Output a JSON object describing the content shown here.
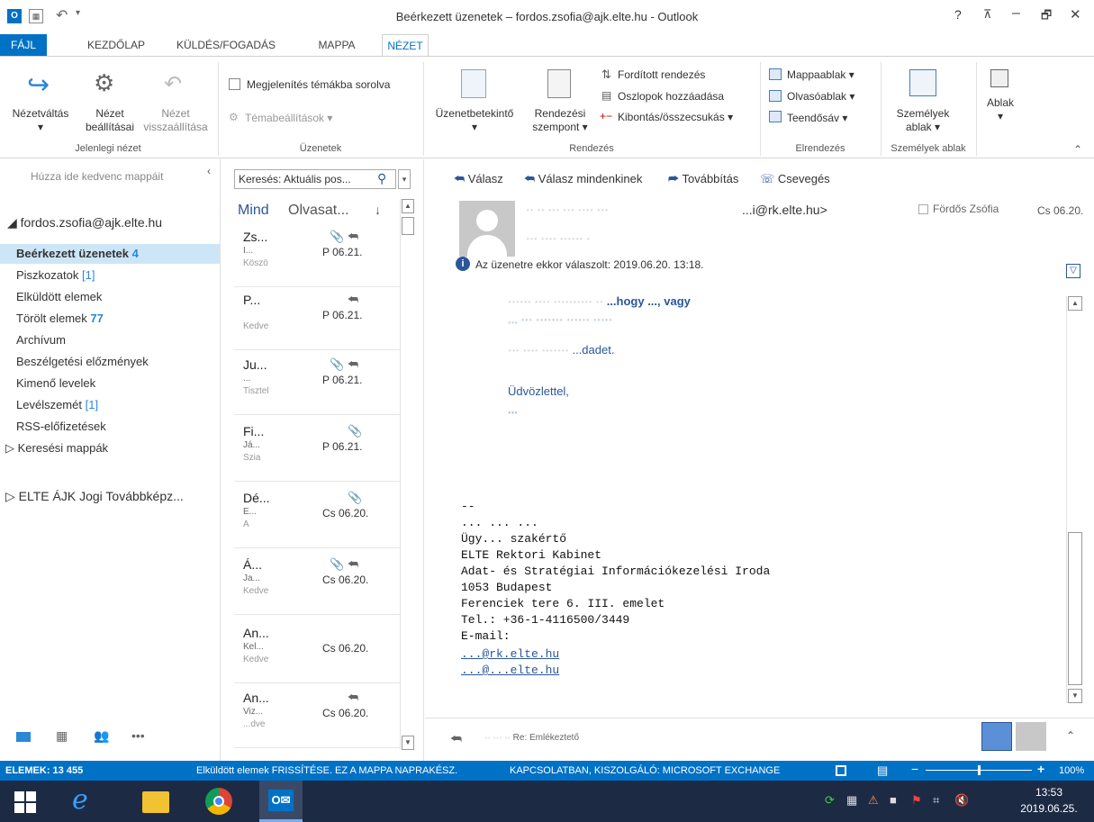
{
  "window": {
    "title": "Beérkezett üzenetek – fordos.zsofia@ajk.elte.hu - Outlook",
    "help": "?",
    "controls": {
      "restore_ribbon": "⊼",
      "minimize": "–",
      "maximize": "🗗",
      "close": "✕"
    }
  },
  "tabs": [
    {
      "label": "FÁJL"
    },
    {
      "label": "KEZDŐLAP"
    },
    {
      "label": "KÜLDÉS/FOGADÁS"
    },
    {
      "label": "MAPPA"
    },
    {
      "label": "NÉZET"
    }
  ],
  "ribbon": {
    "groups": {
      "current_view": {
        "label": "Jelenlegi nézet",
        "change_view": {
          "line1": "Nézetváltás",
          "line2": "▾"
        },
        "view_settings": {
          "line1": "Nézet",
          "line2": "beállításai"
        },
        "reset_view": {
          "line1": "Nézet",
          "line2": "visszaállítása"
        }
      },
      "messages": {
        "label": "Üzenetek",
        "show_as_conversations": "Megjelenítés témákba sorolva",
        "conversation_settings": "Témabeállítások ▾"
      },
      "arrangement": {
        "label": "Rendezés",
        "message_preview": {
          "line1": "Üzenetbetekintő",
          "line2": "▾"
        },
        "arrange_by": {
          "line1": "Rendezési",
          "line2": "szempont ▾"
        },
        "reverse_sort": "Fordított rendezés",
        "add_columns": "Oszlopok hozzáadása",
        "expand_collapse": "Kibontás/összecsukás ▾"
      },
      "layout": {
        "label": "Elrendezés",
        "folder_pane": "Mappaablak ▾",
        "reading_pane": "Olvasóablak ▾",
        "todo_bar": "Teendősáv ▾"
      },
      "people": {
        "label": "Személyek ablak",
        "people_pane": {
          "line1": "Személyek",
          "line2": "ablak ▾"
        }
      },
      "window": {
        "window": {
          "line1": "Ablak",
          "line2": "▾"
        }
      }
    }
  },
  "nav": {
    "favorites_hint": "Húzza ide kedvenc mappáit",
    "account": "◢ fordos.zsofia@ajk.elte.hu",
    "folders": [
      {
        "name": "Beérkezett üzenetek",
        "count": "4"
      },
      {
        "name": "Piszkozatok",
        "count": "[1]"
      },
      {
        "name": "Elküldött elemek",
        "count": ""
      },
      {
        "name": "Törölt elemek",
        "count": "77"
      },
      {
        "name": "Archívum",
        "count": ""
      },
      {
        "name": "Beszélgetési előzmények",
        "count": ""
      },
      {
        "name": "Kimenő levelek",
        "count": ""
      },
      {
        "name": "Levélszemét",
        "count": "[1]"
      },
      {
        "name": "RSS-előfizetések",
        "count": ""
      }
    ],
    "search_folders": "▷ Keresési mappák",
    "other_account": "▷ ELTE ÁJK Jogi Továbbképz...",
    "bottom_more": "•••"
  },
  "list": {
    "search_placeholder": "Keresés: Aktuális pos...",
    "filter_all": "Mind",
    "filter_unread": "Olvasat...",
    "sort_arrow": "↓",
    "messages": [
      {
        "from": "Zs...",
        "subj": "I...",
        "prev": "Köszö",
        "date": "P 06.21.",
        "attach": "📎",
        "reply": "⮪"
      },
      {
        "from": "P...",
        "subj": "",
        "prev": "Kedve",
        "date": "P 06.21.",
        "attach": "",
        "reply": "⮪"
      },
      {
        "from": "Ju...",
        "subj": "...",
        "prev": "Tisztel",
        "date": "P 06.21.",
        "attach": "📎",
        "reply": "⮪"
      },
      {
        "from": "Fi...",
        "subj": "Já...",
        "prev": "Szia",
        "date": "P 06.21.",
        "attach": "📎",
        "reply": ""
      },
      {
        "from": "Dé...",
        "subj": "E...",
        "prev": "A",
        "date": "Cs 06.20.",
        "attach": "📎",
        "reply": ""
      },
      {
        "from": "Á...",
        "subj": "Ja...",
        "prev": "Kedve",
        "date": "Cs 06.20.",
        "attach": "📎",
        "reply": "⮪"
      },
      {
        "from": "An...",
        "subj": "Kel...",
        "prev": "Kedve",
        "date": "Cs 06.20.",
        "attach": "",
        "reply": ""
      },
      {
        "from": "An...",
        "subj": "Viz...",
        "prev": "...dve",
        "date": "Cs 06.20.",
        "attach": "",
        "reply": "⮪"
      }
    ]
  },
  "reading": {
    "toolbar": {
      "reply": "Válasz",
      "reply_all": "Válasz mindenkinek",
      "forward": "Továbbítás",
      "chat": "Csevegés"
    },
    "header": {
      "from_email": "...i@rk.elte.hu>",
      "to": "Fördős Zsófia",
      "date": "Cs 06.20.",
      "info": "Az üzenetre ekkor válaszolt: 2019.06.20. 13:18."
    },
    "body": {
      "line1": "...hogy ..., vagy",
      "line2": "...",
      "line3": "...dadet.",
      "line4": "Üdvözlettel,",
      "line5": "...",
      "sig_dash": "--",
      "sig": [
        "... ... ...",
        "Ügy... szakértő",
        "ELTE Rektori Kabinet",
        "Adat- és Stratégiai Információkezelési Iroda",
        "1053 Budapest",
        "Ferenciek tere 6. III. emelet",
        "Tel.: +36-1-4116500/3449",
        "E-mail:"
      ],
      "link1": "...@rk.elte.hu",
      "link2": "...@...elte.hu"
    },
    "footer": {
      "text": "Re: Emlékeztető"
    }
  },
  "status": {
    "items": "ELEMEK: 13 455",
    "refresh": "Elküldött elemek FRISSÍTÉSE.  EZ A MAPPA NAPRAKÉSZ.",
    "connection": "KAPCSOLATBAN, KISZOLGÁLÓ: MICROSOFT EXCHANGE",
    "zoom": "100%",
    "zoom_level": 0.5
  },
  "taskbar": {
    "time": "13:53",
    "date": "2019.06.25."
  },
  "colors": {
    "accent": "#0072c6",
    "link": "#2b579a",
    "count": "#2b88d8"
  }
}
